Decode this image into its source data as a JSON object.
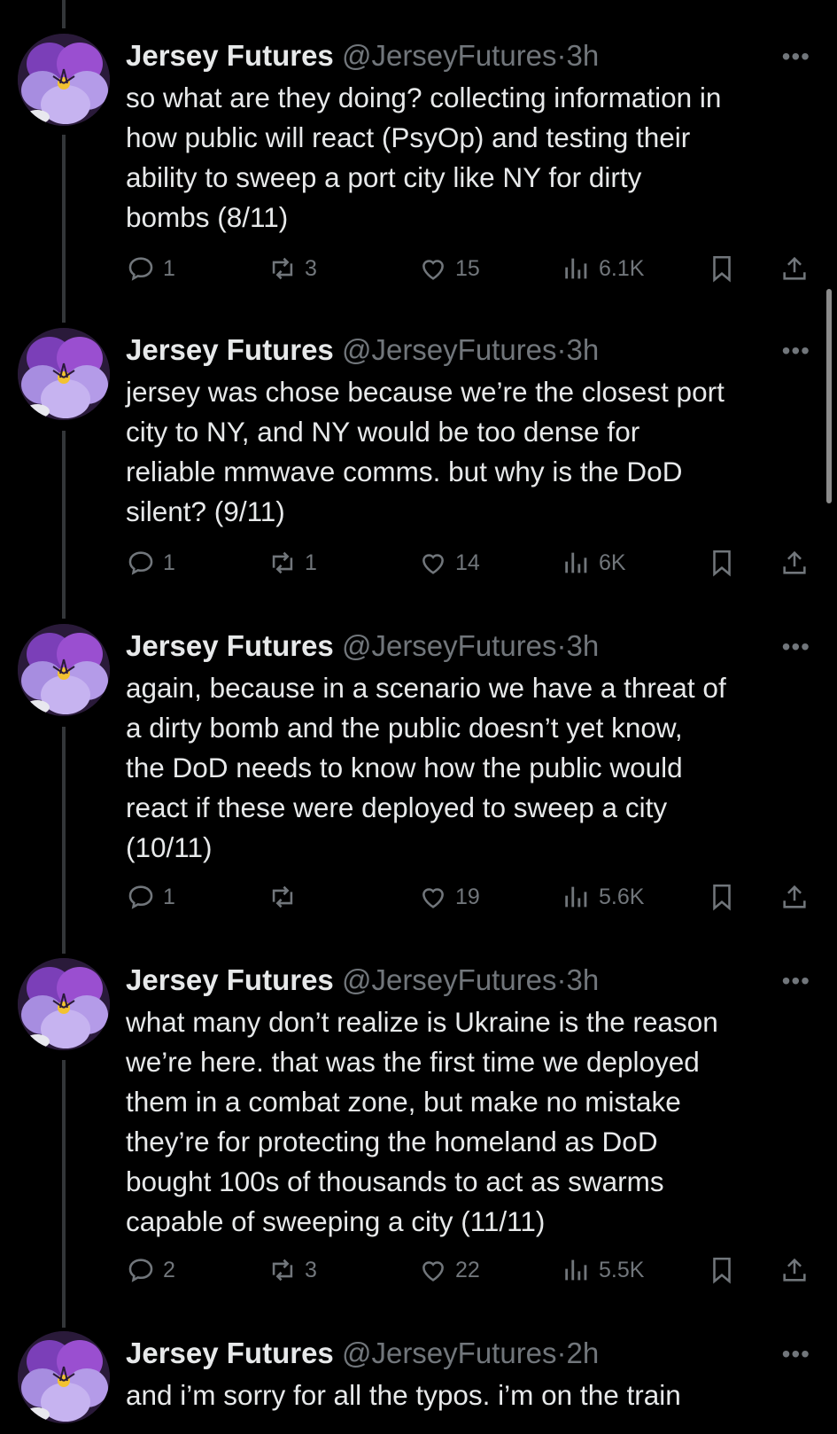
{
  "author": {
    "name": "Jersey Futures",
    "handle": "@JerseyFutures"
  },
  "separator": "·",
  "more_label": "•••",
  "tweets": [
    {
      "time": "3h",
      "text": "so what are they doing? collecting information in\nhow public will react (PsyOp) and testing their\nability to sweep a port city like NY for dirty\nbombs (8/11)",
      "replies": "1",
      "retweets": "3",
      "likes": "15",
      "views": "6.1K"
    },
    {
      "time": "3h",
      "text": "jersey was chose because we’re the closest port\ncity to NY, and NY would be too dense for\nreliable mmwave comms. but why is the DoD\nsilent? (9/11)",
      "replies": "1",
      "retweets": "1",
      "likes": "14",
      "views": "6K"
    },
    {
      "time": "3h",
      "text": "again, because in a scenario we have a threat of\na dirty bomb and the public doesn’t yet know,\nthe DoD needs to know how the public would\nreact if these were deployed to sweep a city\n(10/11)",
      "replies": "1",
      "retweets": "",
      "likes": "19",
      "views": "5.6K"
    },
    {
      "time": "3h",
      "text": "what many don’t realize is Ukraine is the reason\nwe’re here. that was the first time we deployed\nthem in a combat zone, but make no mistake\nthey’re for protecting the homeland as DoD\nbought 100s of thousands to act as swarms\ncapable of sweeping a city (11/11)",
      "replies": "2",
      "retweets": "3",
      "likes": "22",
      "views": "5.5K"
    },
    {
      "time": "2h",
      "text": "and i’m sorry for all the typos. i’m on the train",
      "replies": "",
      "retweets": "",
      "likes": "",
      "views": ""
    }
  ]
}
